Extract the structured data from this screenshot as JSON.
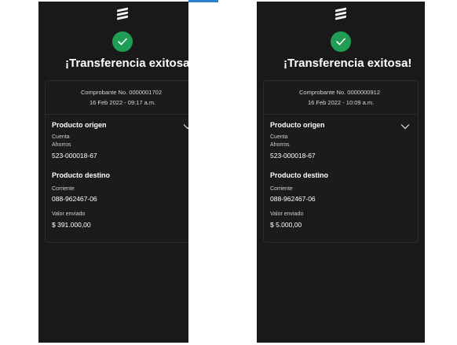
{
  "screens": [
    {
      "success_title": "¡Transferencia exitosa!",
      "voucher": "Comprobante No. 0000001702",
      "datetime": "16 Feb 2022 - 09:17 a.m.",
      "origin": {
        "section_title": "Producto origen",
        "account_type_label": "Cuenta",
        "account_subtype": "Ahorros",
        "account_number": "523-000018-67"
      },
      "destination": {
        "section_title": "Producto destino",
        "account_type": "Corriente",
        "account_number": "088-962467-06"
      },
      "amount": {
        "label": "Valor enviado",
        "value": "$ 391.000,00"
      },
      "icons": {
        "logo": "bank-logo-icon",
        "success": "checkmark-icon",
        "expand": "chevron-down-icon"
      }
    },
    {
      "success_title": "¡Transferencia exitosa!",
      "voucher": "Comprobante No. 0000000912",
      "datetime": "16 Feb 2022 - 10:09 a.m.",
      "origin": {
        "section_title": "Producto origen",
        "account_type_label": "Cuenta",
        "account_subtype": "Ahorros",
        "account_number": "523-000018-67"
      },
      "destination": {
        "section_title": "Producto destino",
        "account_type": "Corriente",
        "account_number": "088-962467-06"
      },
      "amount": {
        "label": "Valor enviado",
        "value": "$ 5.000,00"
      },
      "icons": {
        "logo": "bank-logo-icon",
        "success": "checkmark-icon",
        "expand": "chevron-down-icon"
      }
    }
  ],
  "colors": {
    "phone_background": "#191919",
    "success_green": "#1f9d55",
    "accent_blue": "#2f7fd0",
    "text_primary": "#ffffff"
  }
}
